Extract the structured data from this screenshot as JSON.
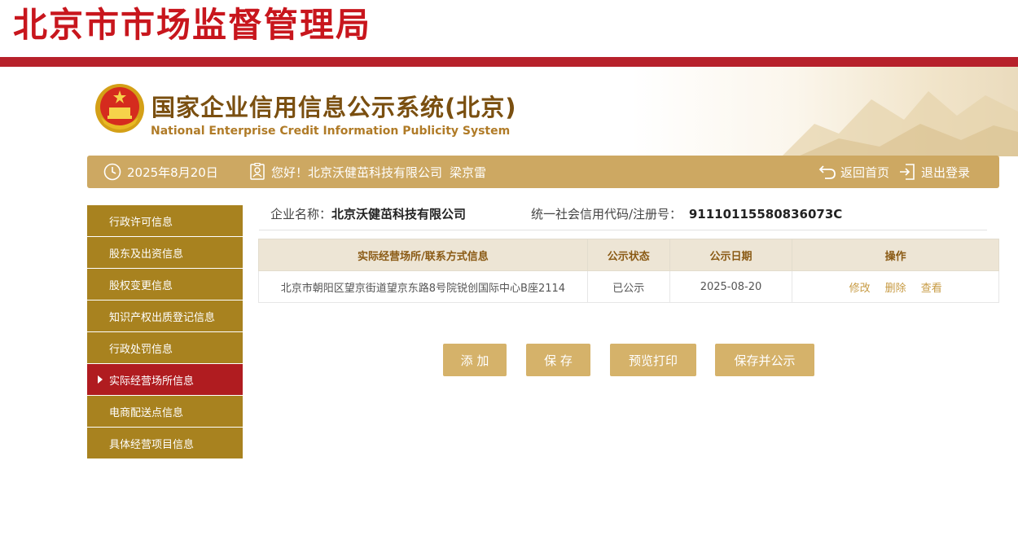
{
  "header": {
    "agency_title": "北京市市场监督管理局"
  },
  "banner": {
    "title": "国家企业信用信息公示系统(北京)",
    "subtitle": "National Enterprise Credit Information Publicity System"
  },
  "info_bar": {
    "date": "2025年8月20日",
    "greeting": "您好！北京沃健茁科技有限公司",
    "user_name": "梁京雷",
    "home_link": "返回首页",
    "logout_link": "退出登录"
  },
  "sidebar": {
    "items": [
      {
        "label": "行政许可信息",
        "active": false
      },
      {
        "label": "股东及出资信息",
        "active": false
      },
      {
        "label": "股权变更信息",
        "active": false
      },
      {
        "label": "知识产权出质登记信息",
        "active": false
      },
      {
        "label": "行政处罚信息",
        "active": false
      },
      {
        "label": "实际经营场所信息",
        "active": true
      },
      {
        "label": "电商配送点信息",
        "active": false
      },
      {
        "label": "具体经营项目信息",
        "active": false
      }
    ]
  },
  "company": {
    "name_label": "企业名称：",
    "name_value": "北京沃健茁科技有限公司",
    "code_label": "统一社会信用代码/注册号：",
    "code_value": "91110115580836073C"
  },
  "table": {
    "columns": [
      "实际经营场所/联系方式信息",
      "公示状态",
      "公示日期",
      "操作"
    ],
    "rows": [
      {
        "address": "北京市朝阳区望京街道望京东路8号院锐创国际中心B座2114",
        "status": "已公示",
        "date": "2025-08-20",
        "actions": [
          "修改",
          "删除",
          "查看"
        ]
      }
    ]
  },
  "buttons": {
    "add": "添 加",
    "save": "保 存",
    "preview_print": "预览打印",
    "save_publish": "保存并公示"
  },
  "colors": {
    "brand_red": "#b7212b",
    "gold_bar": "#cda862",
    "sidebar_gold": "#a8821f",
    "sidebar_active": "#b01c20",
    "button_gold": "#d5b26a"
  }
}
